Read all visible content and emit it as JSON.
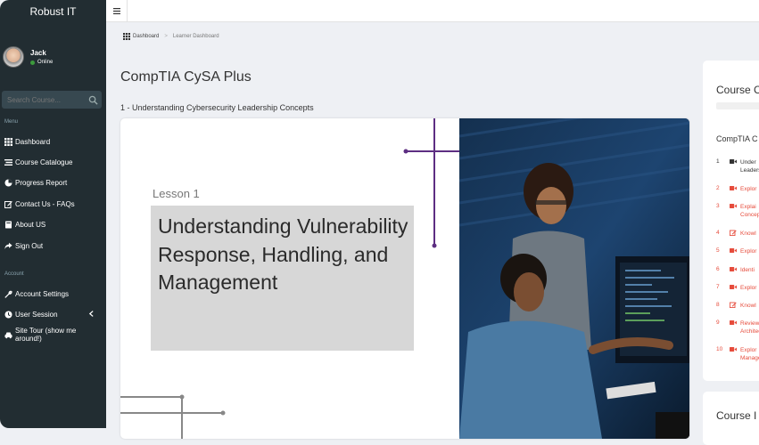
{
  "brand": "Robust IT",
  "user": {
    "name": "Jack",
    "status": "Online"
  },
  "search": {
    "placeholder": "Search Course..."
  },
  "sidebar": {
    "menu_header": "Menu",
    "menu_items": [
      {
        "label": "Dashboard",
        "icon": "grid-icon"
      },
      {
        "label": "Course Catalogue",
        "icon": "list-icon"
      },
      {
        "label": "Progress Report",
        "icon": "pie-chart-icon"
      },
      {
        "label": "Contact Us - FAQs",
        "icon": "edit-icon"
      },
      {
        "label": "About US",
        "icon": "book-icon"
      },
      {
        "label": "Sign Out",
        "icon": "share-icon"
      }
    ],
    "account_header": "Account",
    "account_items": [
      {
        "label": "Account Settings",
        "icon": "wrench-icon"
      },
      {
        "label": "User Session",
        "icon": "clock-icon"
      },
      {
        "label": "Site Tour (show me around!)",
        "icon": "car-icon"
      }
    ]
  },
  "breadcrumb": [
    "Dashboard",
    "Learner Dashboard"
  ],
  "page": {
    "title": "CompTIA CySA Plus",
    "subtitle": "1 - Understanding Cybersecurity Leadership Concepts"
  },
  "slide": {
    "lesson_label": "Lesson 1",
    "lesson_title": "Understanding Vulnerability Response, Handling, and Management"
  },
  "course_panel": {
    "title": "Course C",
    "subtitle": "CompTIA C",
    "items": [
      {
        "num": "1",
        "text": "Under\nLeadership",
        "type": "video",
        "color": "#333333"
      },
      {
        "num": "2",
        "text": "Explor",
        "type": "video",
        "color": "#e64c3c"
      },
      {
        "num": "3",
        "text": "Explai\nConcepts",
        "type": "video",
        "color": "#e64c3c"
      },
      {
        "num": "4",
        "text": "Knowl",
        "type": "quiz",
        "color": "#e64c3c"
      },
      {
        "num": "5",
        "text": "Explor",
        "type": "video",
        "color": "#e64c3c"
      },
      {
        "num": "6",
        "text": "Identi",
        "type": "video",
        "color": "#e64c3c"
      },
      {
        "num": "7",
        "text": "Explor",
        "type": "video",
        "color": "#e64c3c"
      },
      {
        "num": "8",
        "text": "Knowl",
        "type": "quiz",
        "color": "#e64c3c"
      },
      {
        "num": "9",
        "text": "Review\nArchitectu",
        "type": "video",
        "color": "#e64c3c"
      },
      {
        "num": "10",
        "text": "Explor\nManagem",
        "type": "video",
        "color": "#e64c3c"
      }
    ]
  },
  "course_panel2": {
    "title": "Course I"
  }
}
